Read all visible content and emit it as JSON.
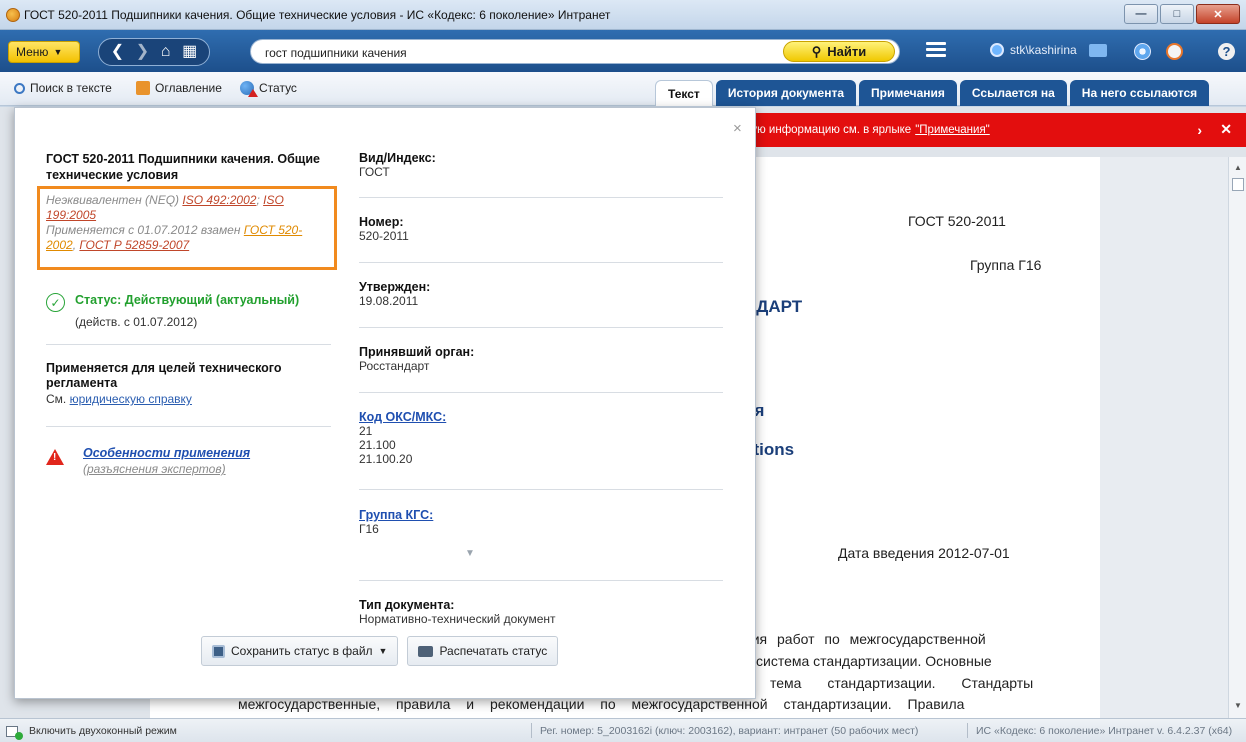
{
  "window": {
    "title": "ГОСТ 520-2011 Подшипники качения. Общие технические условия - ИС «Кодекс: 6 поколение» Интранет"
  },
  "toolbar": {
    "menu_label": "Меню",
    "search_value": "гост подшипники качения",
    "find_label": "Найти",
    "user_name": "stk\\kashirina"
  },
  "subbar": {
    "search_in_text": "Поиск в тексте",
    "contents": "Оглавление",
    "status": "Статус"
  },
  "tabs": [
    {
      "label": "Текст",
      "active": true
    },
    {
      "label": "История документа"
    },
    {
      "label": "Примечания"
    },
    {
      "label": "Ссылается на"
    },
    {
      "label": "На него ссылаются"
    }
  ],
  "infobar": {
    "text": "ную информацию см. в ярлыке",
    "link": "\"Примечания\""
  },
  "document": {
    "number_label": "ГОСТ 520-2011",
    "group_label": "Группа Г16",
    "heading_fragment_1": "НДАРТ",
    "heading_fragment_2": "I",
    "heading_fragment_3": "ия",
    "heading_fragment_4": "ations",
    "intro_date": "Дата введения 2012-07-01",
    "para_line_1": "ния работ по межгосударственной",
    "para_line_2": "система стандартизации. Основные",
    "para_line_3": "тема стандартизации. Стандарты",
    "para_line_4": "межгосударственные, правила и рекомендации по межгосударственной стандартизации. Правила"
  },
  "popup": {
    "close": "×",
    "doc_title": "ГОСТ 520-2011 Подшипники качения. Общие технические условия",
    "neq_prefix": "Неэквивалентен (NEQ) ",
    "neq_link_1": "ISO 492:2002",
    "neq_sep": "; ",
    "neq_link_2": "ISO 199:2005",
    "replaces_prefix": "Применяется с 01.07.2012 взамен ",
    "replaces_link_1": "ГОСТ 520-2002",
    "replaces_sep": ", ",
    "replaces_link_2": "ГОСТ Р 52859-2007",
    "status_text": "Статус: Действующий (актуальный)",
    "status_since": "(действ. с 01.07.2012)",
    "regulation_title": "Применяется для целей технического регламента",
    "regulation_see": "См. ",
    "regulation_link": "юридическую справку",
    "features_link": "Особенности применения",
    "features_sub": "(разъяснения экспертов)",
    "fields": {
      "type_index_label": "Вид/Индекс:",
      "type_index_value": "ГОСТ",
      "number_label": "Номер:",
      "number_value": "520-2011",
      "approved_label": "Утвержден:",
      "approved_value": "19.08.2011",
      "body_label": "Принявший орган:",
      "body_value": "Росстандарт",
      "oks_label": "Код ОКС/МКС:",
      "oks_values": [
        "21",
        "21.100",
        "21.100.20"
      ],
      "kgs_label": "Группа КГС:",
      "kgs_value": "Г16",
      "doctype_label": "Тип документа:",
      "doctype_value": "Нормативно-технический документ"
    },
    "save_button": "Сохранить статус в файл",
    "print_button": "Распечатать статус"
  },
  "statusbar": {
    "twin_mode": "Включить двухоконный режим",
    "registration": "Рег. номер: 5_2003162i (ключ: 2003162), вариант: интранет (50 рабочих мест)",
    "version": "ИС «Кодекс: 6 поколение» Интранет v. 6.4.2.37 (x64)"
  }
}
